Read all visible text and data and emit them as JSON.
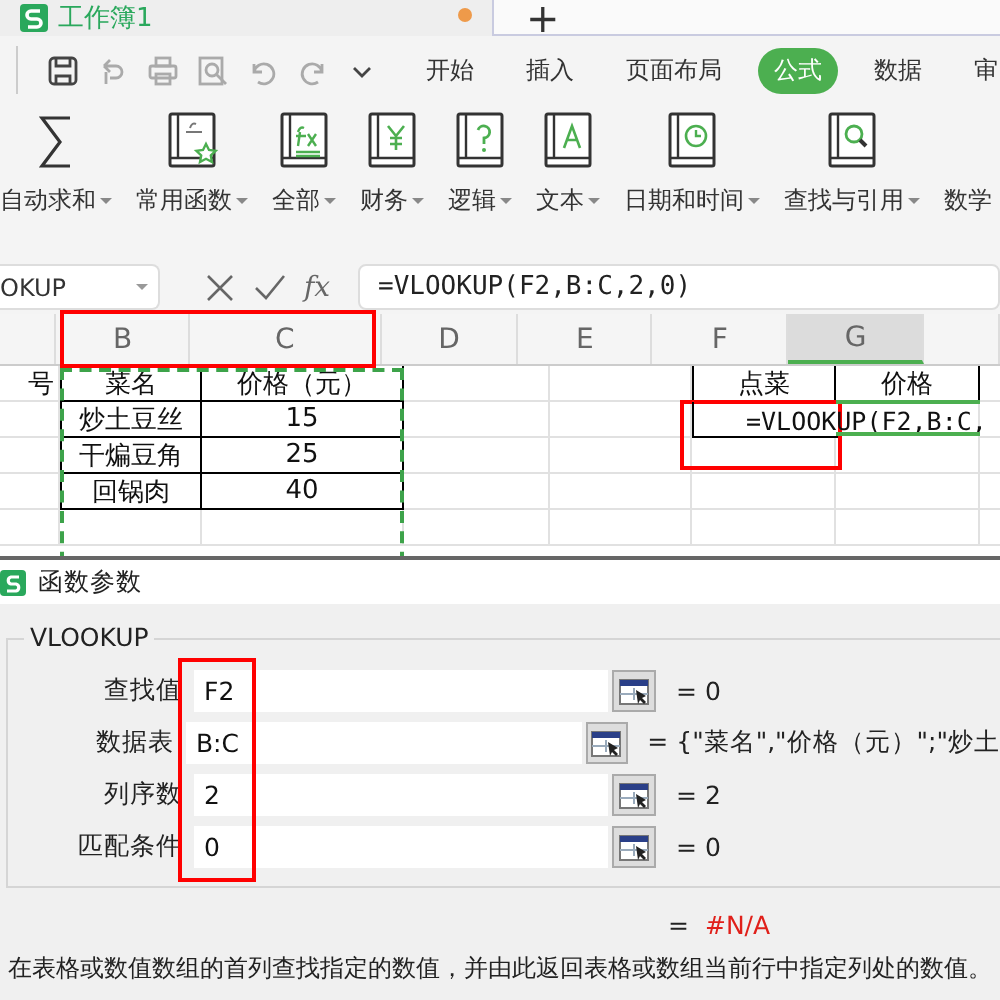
{
  "title_tab": {
    "label": "工作簿1",
    "modified": true
  },
  "new_tab": "+",
  "menu_tabs": [
    {
      "label": "开始",
      "selected": false
    },
    {
      "label": "插入",
      "selected": false
    },
    {
      "label": "页面布局",
      "selected": false
    },
    {
      "label": "公式",
      "selected": true
    },
    {
      "label": "数据",
      "selected": false
    },
    {
      "label": "审",
      "selected": false
    }
  ],
  "ribbon": [
    {
      "label": "自动求和",
      "kind": "sum"
    },
    {
      "label": "常用函数",
      "kind": "fx-star"
    },
    {
      "label": "全部",
      "kind": "fx"
    },
    {
      "label": "财务",
      "kind": "yen"
    },
    {
      "label": "逻辑",
      "kind": "question"
    },
    {
      "label": "文本",
      "kind": "letter"
    },
    {
      "label": "日期和时间",
      "kind": "clock"
    },
    {
      "label": "查找与引用",
      "kind": "magnifier"
    },
    {
      "label": "数学",
      "kind": "none"
    }
  ],
  "formula_bar": {
    "name_box": "OKUP",
    "fx": "fx",
    "formula": "=VLOOKUP(F2,B:C,2,0)"
  },
  "columns": [
    {
      "label": "B",
      "selected": false
    },
    {
      "label": "C",
      "selected": false
    },
    {
      "label": "D",
      "selected": false
    },
    {
      "label": "E",
      "selected": false
    },
    {
      "label": "F",
      "selected": false
    },
    {
      "label": "G",
      "selected": true
    }
  ],
  "rows": [
    [
      "号",
      "菜名",
      "价格（元）",
      null,
      null,
      "点菜",
      "价格",
      null
    ],
    [
      null,
      "炒土豆丝",
      "15",
      null,
      null,
      "=VLOOKUP(F2,B:C,",
      null,
      null
    ],
    [
      null,
      "干煸豆角",
      "25",
      null,
      null,
      null,
      null,
      null
    ],
    [
      null,
      "回锅肉",
      "40",
      null,
      null,
      null,
      null,
      null
    ]
  ],
  "dialog": {
    "title": "函数参数",
    "function": "VLOOKUP",
    "args": [
      {
        "label": "查找值",
        "value": "F2",
        "result": "= 0"
      },
      {
        "label": "数据表",
        "value": "B:C",
        "result": "= {\"菜名\",\"价格（元）\";\"炒土"
      },
      {
        "label": "列序数",
        "value": "2",
        "result": "= 2"
      },
      {
        "label": "匹配条件",
        "value": "0",
        "result": "= 0"
      }
    ],
    "result_sign": "=",
    "result": "#N/A",
    "description": "在表格或数值数组的首列查找指定的数值，并由此返回表格或数组当前行中指定列处的数值。"
  },
  "annotations": [
    {
      "kind": "column-headers"
    },
    {
      "kind": "formula-cell"
    },
    {
      "kind": "argument-values"
    }
  ]
}
